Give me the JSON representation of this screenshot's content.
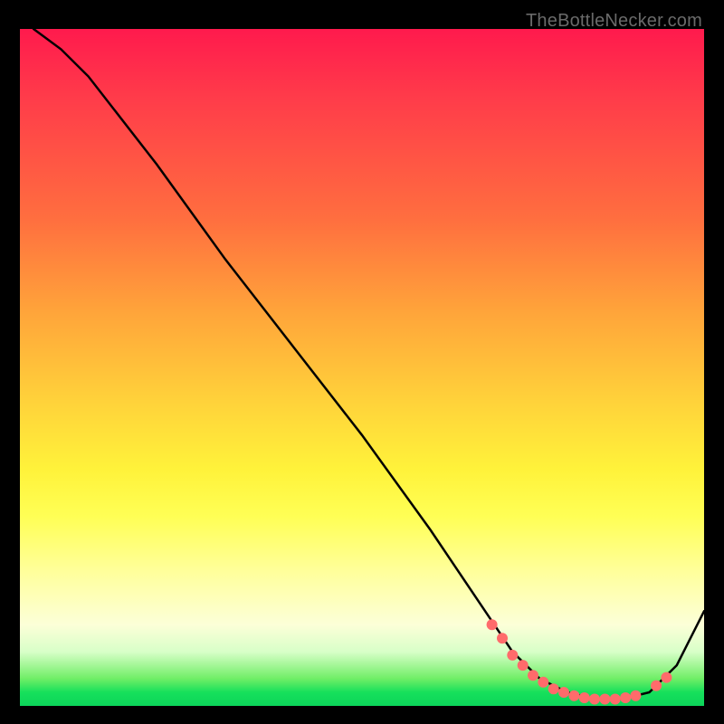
{
  "watermark": "TheBottleNecker.com",
  "chart_data": {
    "type": "line",
    "title": "",
    "xlabel": "",
    "ylabel": "",
    "xlim": [
      0,
      100
    ],
    "ylim": [
      0,
      100
    ],
    "grid": false,
    "legend": false,
    "background_gradient": [
      "#ff1a4d",
      "#ff6e3f",
      "#ffd23a",
      "#ffff9a",
      "#6fee66",
      "#0cd45a"
    ],
    "series": [
      {
        "name": "bottleneck-curve",
        "color": "#000000",
        "x": [
          2,
          6,
          10,
          20,
          30,
          40,
          50,
          60,
          68,
          72,
          76,
          80,
          84,
          88,
          92,
          96,
          100
        ],
        "y": [
          100,
          97,
          93,
          80,
          66,
          53,
          40,
          26,
          14,
          8,
          4,
          2,
          1,
          1,
          2,
          6,
          14
        ]
      }
    ],
    "markers": [
      {
        "name": "highlight-dots",
        "color": "#ff6b6b",
        "radius_px": 6,
        "points": [
          {
            "x": 69,
            "y": 12
          },
          {
            "x": 70.5,
            "y": 10
          },
          {
            "x": 72,
            "y": 7.5
          },
          {
            "x": 73.5,
            "y": 6
          },
          {
            "x": 75,
            "y": 4.5
          },
          {
            "x": 76.5,
            "y": 3.5
          },
          {
            "x": 78,
            "y": 2.5
          },
          {
            "x": 79.5,
            "y": 2
          },
          {
            "x": 81,
            "y": 1.5
          },
          {
            "x": 82.5,
            "y": 1.2
          },
          {
            "x": 84,
            "y": 1
          },
          {
            "x": 85.5,
            "y": 1
          },
          {
            "x": 87,
            "y": 1
          },
          {
            "x": 88.5,
            "y": 1.2
          },
          {
            "x": 90,
            "y": 1.5
          },
          {
            "x": 93,
            "y": 3
          },
          {
            "x": 94.5,
            "y": 4.2
          }
        ]
      }
    ]
  }
}
